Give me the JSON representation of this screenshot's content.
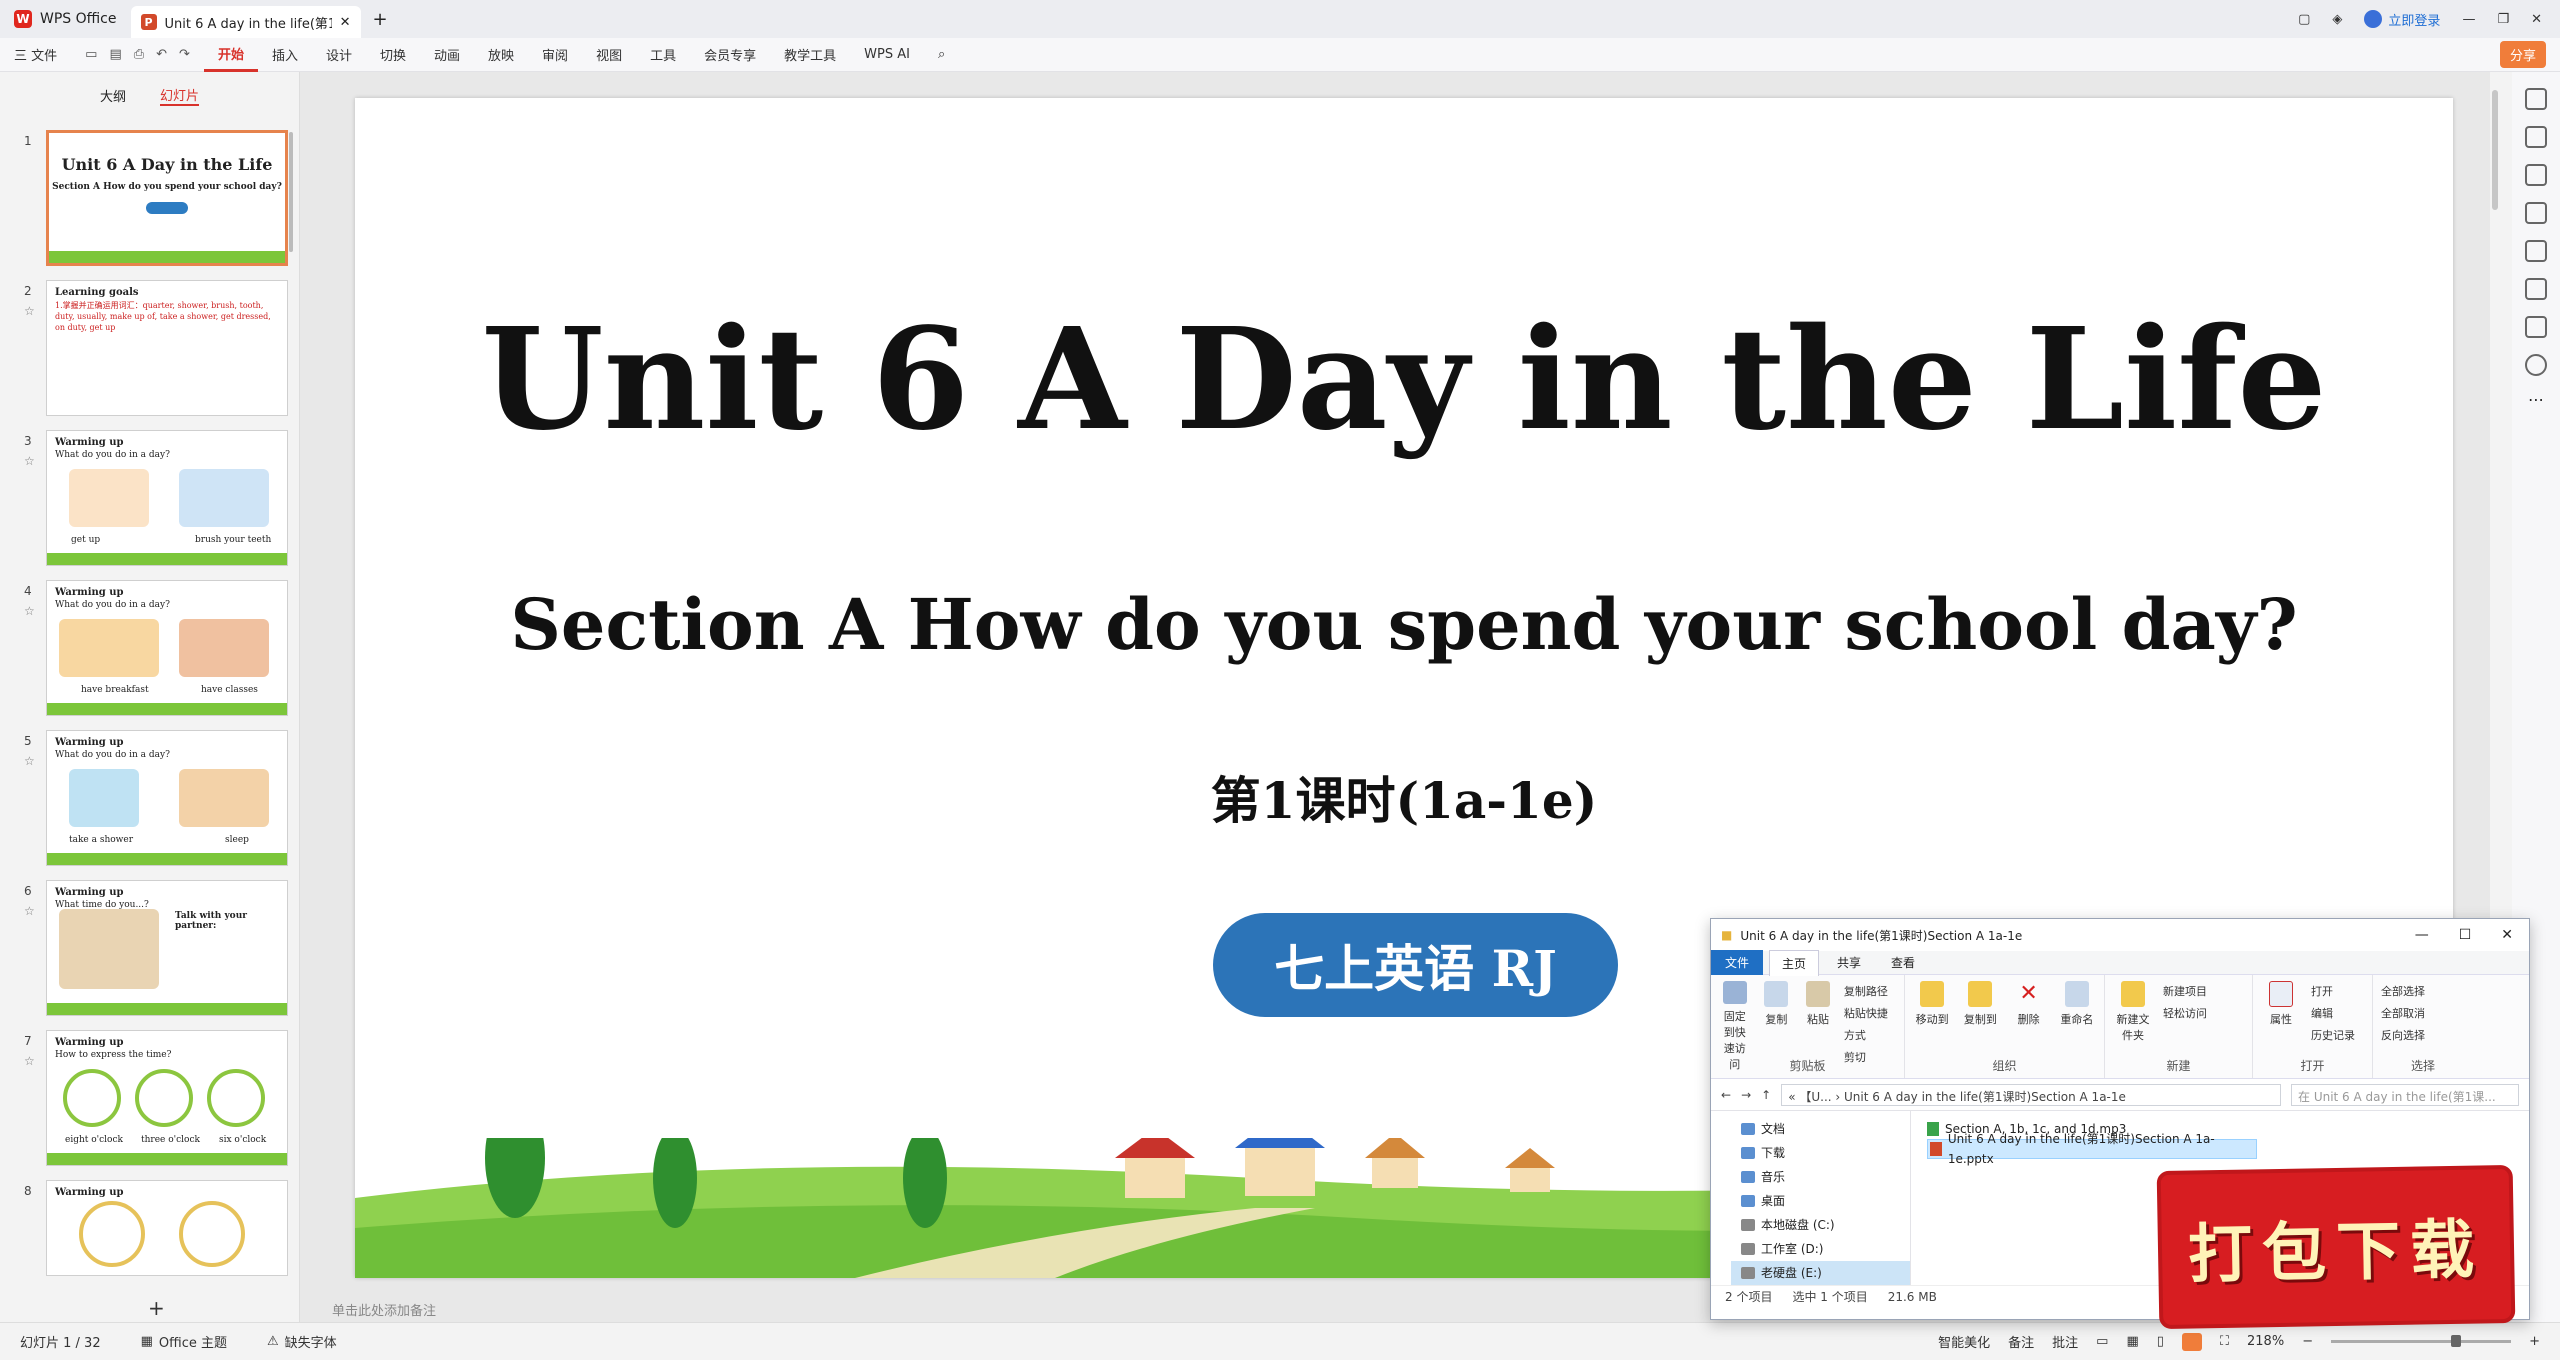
{
  "titlebar": {
    "app_name": "WPS Office",
    "doc_tab": "Unit 6 A day in the life(第1课",
    "login": "立即登录"
  },
  "ribbon": {
    "file_menu": "三 文件",
    "tabs": [
      "开始",
      "插入",
      "设计",
      "切换",
      "动画",
      "放映",
      "审阅",
      "视图",
      "工具",
      "会员专享",
      "教学工具"
    ],
    "active_tab": "开始",
    "wps_ai": "WPS AI",
    "share": "分享"
  },
  "left_panel": {
    "tab_outline": "大纲",
    "tab_slides": "幻灯片",
    "slide_numbers": [
      "1",
      "2",
      "3",
      "4",
      "5",
      "6",
      "7",
      "8"
    ],
    "thumbs": {
      "t1_title": "Unit 6 A Day in the Life",
      "t1_sub": "Section A How do you spend your school day?",
      "t2_title": "Learning goals",
      "t2_line": "1.掌握并正确运用词汇：quarter, shower, brush, tooth, duty, usually, make up of, take a shower, get dressed, on duty, get up",
      "t3_title": "Warming up",
      "t3_sub": "What do you do in a day?",
      "t3_labels": [
        "get up",
        "brush your teeth"
      ],
      "t4_labels": [
        "have breakfast",
        "have classes"
      ],
      "t5_labels": [
        "take a shower",
        "sleep"
      ],
      "t6_sub": "What time do you...?",
      "t6_talk": "Talk with your partner:",
      "t7_sub": "How to express the time?",
      "t7_labels": [
        "eight o'clock",
        "three o'clock",
        "six o'clock"
      ]
    }
  },
  "slide": {
    "title": "Unit 6 A Day in the Life",
    "subtitle": "Section A How do you spend your school day?",
    "period": "第1课时(1a-1e)",
    "pill": "七上英语 RJ"
  },
  "notes_placeholder": "单击此处添加备注",
  "status": {
    "slide_count": "幻灯片 1 / 32",
    "theme": "Office 主题",
    "missing_font": "缺失字体",
    "beautify": "智能美化",
    "notes": "备注",
    "comment": "批注",
    "zoom": "218%"
  },
  "explorer": {
    "title": "Unit 6 A day in the life(第1课时)Section A 1a-1e",
    "menu": [
      "文件",
      "主页",
      "共享",
      "查看"
    ],
    "groups": {
      "clipboard": "剪贴板",
      "organize": "组织",
      "new": "新建",
      "open": "打开",
      "select": "选择"
    },
    "buttons": {
      "pin": "固定到快速访问",
      "copy": "复制",
      "paste": "粘贴",
      "copy_path": "复制路径",
      "paste_shortcut": "粘贴快捷方式",
      "cut": "剪切",
      "move_to": "移动到",
      "copy_to": "复制到",
      "delete": "删除",
      "rename": "重命名",
      "new_folder": "新建文件夹",
      "new_item": "新建项目",
      "easy_access": "轻松访问",
      "properties": "属性",
      "open": "打开",
      "edit": "编辑",
      "history": "历史记录",
      "select_all": "全部选择",
      "select_none": "全部取消",
      "invert": "反向选择"
    },
    "address": "« 【U... › Unit 6 A day in the life(第1课时)Section A 1a-1e",
    "search_placeholder": "在 Unit 6 A day in the life(第1课...",
    "nav": [
      "文档",
      "下载",
      "音乐",
      "桌面",
      "本地磁盘 (C:)",
      "工作室 (D:)",
      "老硬盘 (E:)"
    ],
    "files": [
      "Section A, 1b, 1c, and 1d.mp3",
      "Unit 6 A day in the life(第1课时)Section A 1a-1e.pptx"
    ],
    "status_items": "2 个项目",
    "status_selected": "选中 1 个项目",
    "status_size": "21.6 MB"
  },
  "banner": "打包下载"
}
